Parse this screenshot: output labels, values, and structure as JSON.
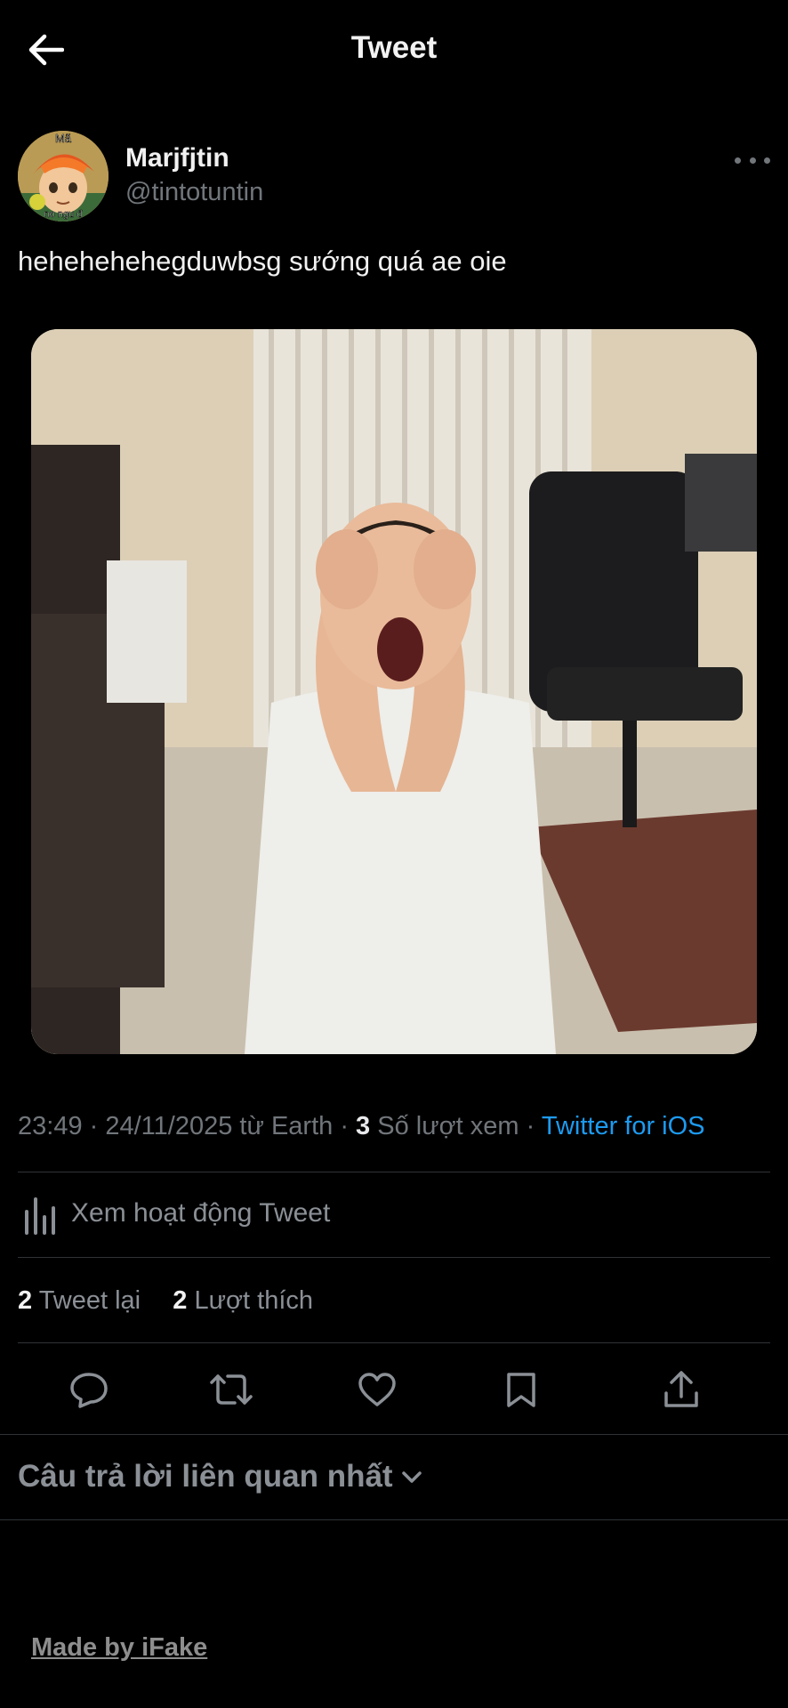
{
  "header": {
    "title": "Tweet",
    "back_icon": "arrow-left-icon"
  },
  "author": {
    "name": "Marjfjtin",
    "handle": "@tintotuntin",
    "avatar_caption": "Mã",
    "avatar_bottom_text": "no ngu đ"
  },
  "tweet": {
    "text": "hehehehehegduwbsg sướng quá ae oie",
    "time": "23:49",
    "date": "24/11/2025",
    "location": "từ Earth",
    "views_count": "3",
    "views_label": "Số lượt xem",
    "source": "Twitter for iOS"
  },
  "activity": {
    "label": "Xem hoạt động Tweet",
    "icon": "bar-chart-icon"
  },
  "stats": {
    "retweets_count": "2",
    "retweets_label": "Tweet lại",
    "likes_count": "2",
    "likes_label": "Lượt thích"
  },
  "actions": [
    "reply-icon",
    "retweet-icon",
    "like-icon",
    "bookmark-icon",
    "share-icon"
  ],
  "replies": {
    "sort_label": "Câu trả lời liên quan nhất"
  },
  "watermark": "Made by iFake",
  "colors": {
    "background": "#000000",
    "accent_link": "#1d9bf0",
    "muted_text": "#71767b",
    "divider": "#2f3336"
  }
}
